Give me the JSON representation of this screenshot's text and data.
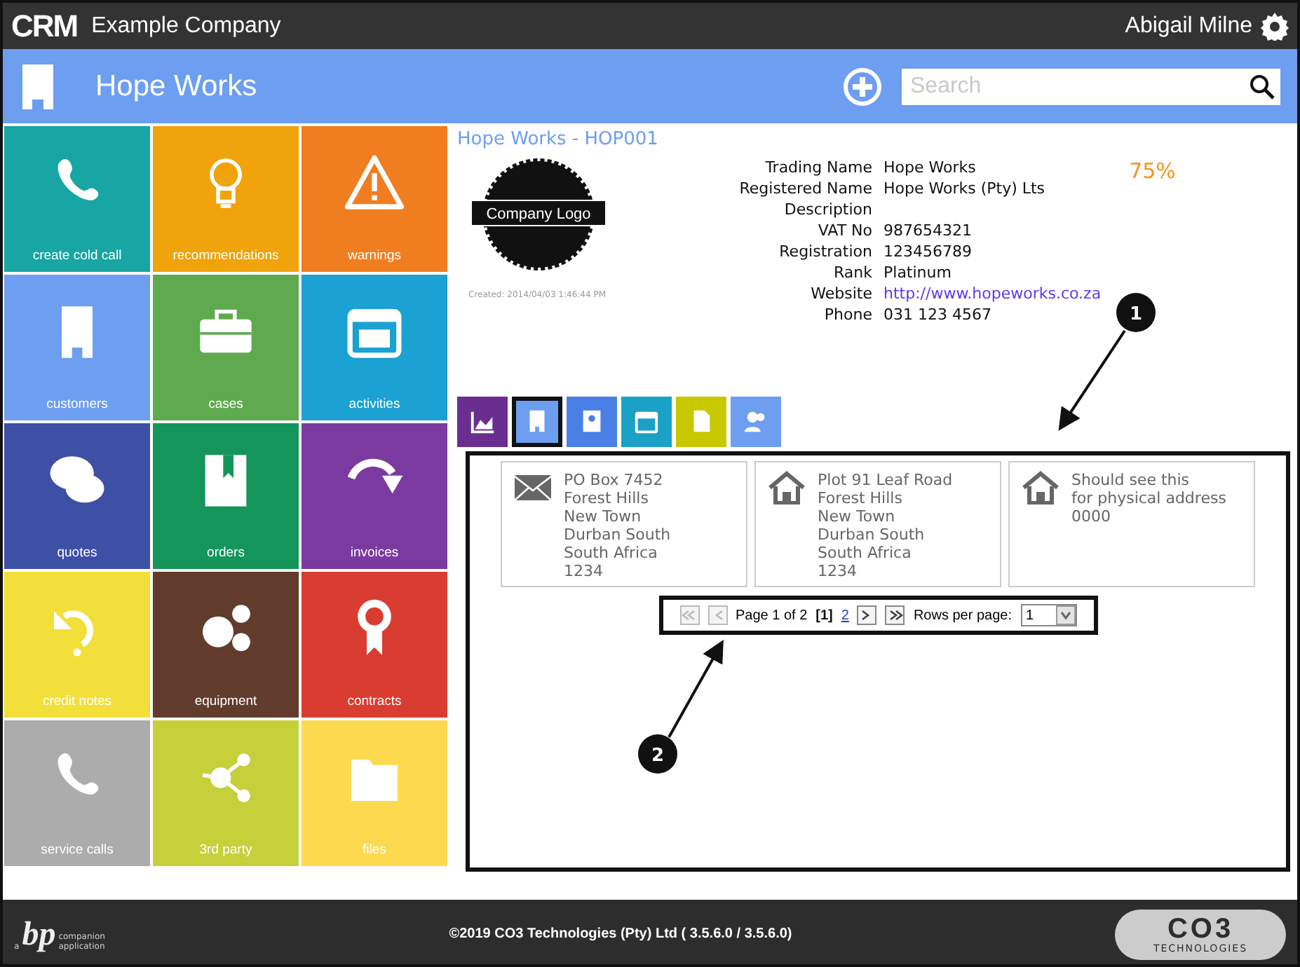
{
  "header": {
    "logo": "CRM",
    "company": "Example Company",
    "user": "Abigail Milne"
  },
  "title_bar": {
    "title": "Hope Works",
    "search": {
      "placeholder": "Search"
    }
  },
  "tiles": [
    {
      "label": "create cold call",
      "color": "#17a6a3"
    },
    {
      "label": "recommendations",
      "color": "#f0a30a"
    },
    {
      "label": "warnings",
      "color": "#f07d1f"
    },
    {
      "label": "customers",
      "color": "#6d9ef0"
    },
    {
      "label": "cases",
      "color": "#5faa4f"
    },
    {
      "label": "activities",
      "color": "#1ba1d2"
    },
    {
      "label": "quotes",
      "color": "#3e4fa6"
    },
    {
      "label": "orders",
      "color": "#14965a"
    },
    {
      "label": "invoices",
      "color": "#7b3aa0"
    },
    {
      "label": "credit notes",
      "color": "#f3df3a"
    },
    {
      "label": "equipment",
      "color": "#613c2c"
    },
    {
      "label": "contracts",
      "color": "#d93c30"
    },
    {
      "label": "service calls",
      "color": "#acacac"
    },
    {
      "label": "3rd party",
      "color": "#c5d03a"
    },
    {
      "label": "files",
      "color": "#fdd94f"
    }
  ],
  "company": {
    "heading": "Hope Works - HOP001",
    "logo_text": "Company Logo",
    "created": "Created: 2014/04/03 1:46:44 PM",
    "score": "75%",
    "fields": [
      {
        "label": "Trading Name",
        "value": "Hope Works",
        "kind": "text"
      },
      {
        "label": "Registered Name",
        "value": "Hope Works (Pty) Lts",
        "kind": "text"
      },
      {
        "label": "Description",
        "kind": "text"
      },
      {
        "label": "VAT No",
        "value": "987654321",
        "kind": "text"
      },
      {
        "label": "Registration",
        "value": "123456789",
        "kind": "text"
      },
      {
        "label": "Rank",
        "value": "Platinum",
        "kind": "text"
      },
      {
        "label": "Website",
        "value": "http://www.hopeworks.co.za",
        "kind": "link"
      },
      {
        "label": "Phone",
        "value": "031 123 4567",
        "kind": "text"
      }
    ]
  },
  "tabs": [
    {
      "color": "#6a2e91",
      "selected": false
    },
    {
      "color": "#6d9ef0",
      "selected": true
    },
    {
      "color": "#4a80e6",
      "selected": false
    },
    {
      "color": "#1ba1c6",
      "selected": false
    },
    {
      "color": "#c8c800",
      "selected": false
    },
    {
      "color": "#6d9ef0",
      "selected": false
    }
  ],
  "addresses": [
    {
      "kind": "postal",
      "lines": [
        "PO Box 7452",
        "Forest Hills",
        "New Town",
        "Durban South",
        "South Africa",
        "1234"
      ]
    },
    {
      "kind": "physical",
      "lines": [
        "Plot 91 Leaf Road",
        "Forest Hills",
        "New Town",
        "Durban South",
        "South Africa",
        "1234"
      ]
    },
    {
      "kind": "physical",
      "lines": [
        "Should see this",
        "for physical address",
        "0000"
      ]
    }
  ],
  "pager": {
    "summary": "Page 1 of 2",
    "pages": [
      {
        "label": "[1]",
        "selected": true
      },
      {
        "label": "2",
        "selected": false
      }
    ],
    "rows_label": "Rows per page:",
    "rows_value": "1"
  },
  "annotations": [
    {
      "label": "1"
    },
    {
      "label": "2"
    }
  ],
  "footer": {
    "bp_small": "a",
    "bp_logo": "bp",
    "bp_line1": "companion",
    "bp_line2": "application",
    "copyright": "©2019 CO3 Technologies (Pty) Ltd ( 3.5.6.0 / 3.5.6.0)",
    "co3_logo": "CO3",
    "co3_sub": "TECHNOLOGIES"
  }
}
